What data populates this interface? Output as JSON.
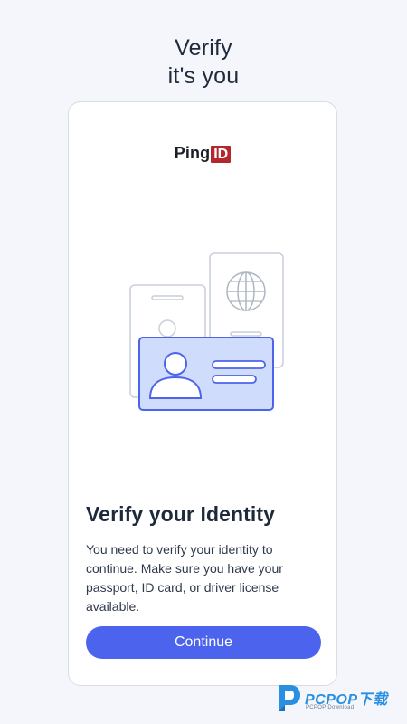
{
  "header": {
    "title_line1": "Verify",
    "title_line2": "it's you"
  },
  "card": {
    "logo": {
      "text": "Ping",
      "badge": "ID",
      "badge_color": "#b3282d"
    },
    "illustration": {
      "icons": [
        "id-card-icon",
        "passport-icon",
        "badge-icon"
      ]
    },
    "title": "Verify your Identity",
    "body": "You need to verify your identity to continue. Make sure you have your passport, ID card, or driver license available.",
    "continue_label": "Continue",
    "accent_color": "#4c63ed"
  },
  "watermark": {
    "brand": "PCPOP下载",
    "sub": "PCPOP Download"
  }
}
